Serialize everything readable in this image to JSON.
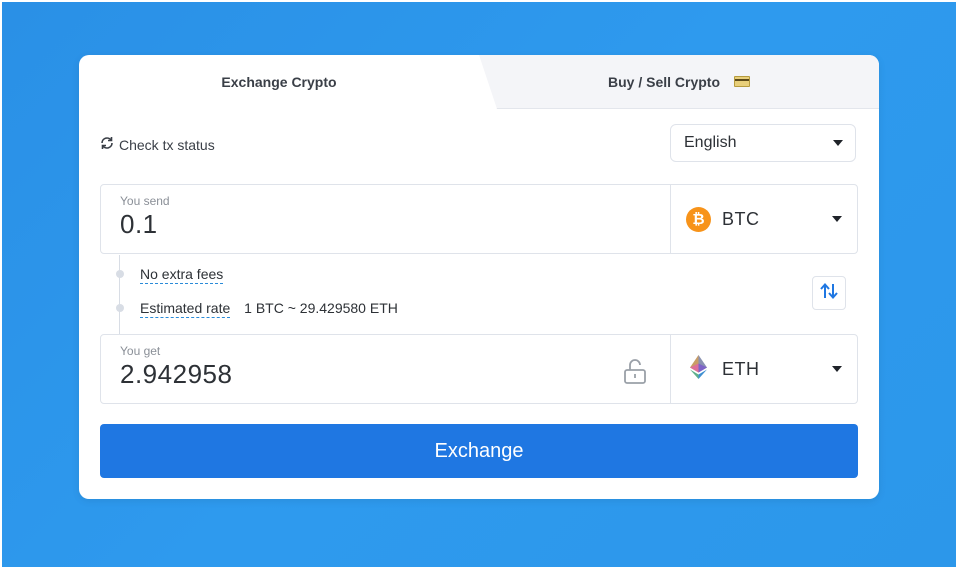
{
  "tabs": {
    "exchange_label": "Exchange Crypto",
    "buy_sell_label": "Buy / Sell Crypto"
  },
  "check_status": {
    "label": "Check tx status"
  },
  "language": {
    "selected": "English"
  },
  "send": {
    "label": "You send",
    "value": "0.1",
    "currency": "BTC",
    "currency_icon": "btc-coin-icon"
  },
  "info": {
    "fees_label": "No extra fees",
    "rate_label": "Estimated rate",
    "rate_value": "1 BTC ~ 29.429580 ETH"
  },
  "get": {
    "label": "You get",
    "value": "2.942958",
    "currency": "ETH",
    "currency_icon": "eth-diamond-icon"
  },
  "exchange_button": {
    "label": "Exchange"
  },
  "colors": {
    "background": "#2c97ea",
    "button": "#1f77e2",
    "btc": "#f7931a",
    "swap_arrows": "#1f77e2"
  }
}
